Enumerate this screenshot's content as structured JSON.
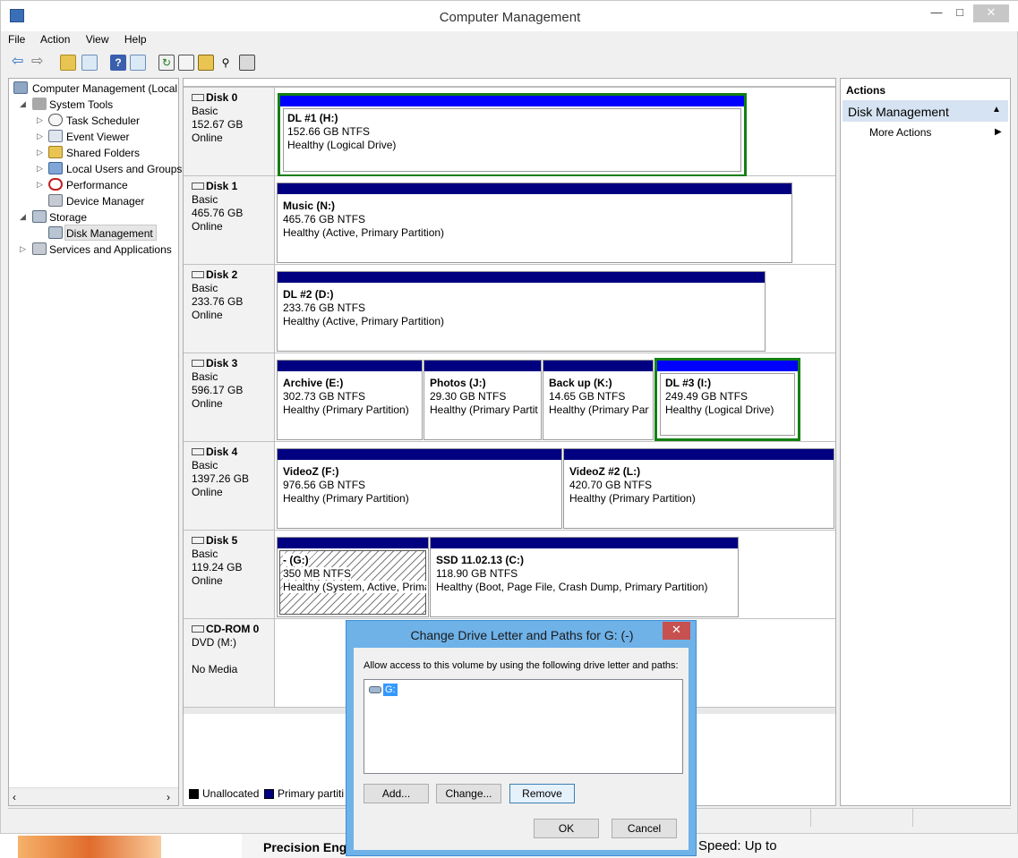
{
  "window": {
    "title": "Computer Management",
    "minimize": "—",
    "maximize": "□",
    "close": "✕"
  },
  "menu": [
    "File",
    "Action",
    "View",
    "Help"
  ],
  "toolbar": {
    "icons": [
      "back-icon",
      "forward-icon",
      "up-folder-icon",
      "show-hide-tree-icon",
      "help-icon",
      "properties-icon",
      "refresh-icon",
      "settings-icon",
      "open-folder-icon",
      "search-icon",
      "export-icon"
    ]
  },
  "tree": {
    "root": "Computer Management (Local",
    "system_tools": "System Tools",
    "task_scheduler": "Task Scheduler",
    "event_viewer": "Event Viewer",
    "shared_folders": "Shared Folders",
    "local_users": "Local Users and Groups",
    "performance": "Performance",
    "device_manager": "Device Manager",
    "storage": "Storage",
    "disk_management": "Disk Management",
    "services": "Services and Applications"
  },
  "disks": [
    {
      "name": "Disk 0",
      "type": "Basic",
      "size": "152.67 GB",
      "status": "Online",
      "parts": [
        {
          "name": "DL #1  (H:)",
          "size": "152.66 GB NTFS",
          "status": "Healthy (Logical Drive)"
        }
      ]
    },
    {
      "name": "Disk 1",
      "type": "Basic",
      "size": "465.76 GB",
      "status": "Online",
      "parts": [
        {
          "name": "Music  (N:)",
          "size": "465.76 GB NTFS",
          "status": "Healthy (Active, Primary Partition)"
        }
      ]
    },
    {
      "name": "Disk 2",
      "type": "Basic",
      "size": "233.76 GB",
      "status": "Online",
      "parts": [
        {
          "name": "DL #2  (D:)",
          "size": "233.76 GB NTFS",
          "status": "Healthy (Active, Primary Partition)"
        }
      ]
    },
    {
      "name": "Disk 3",
      "type": "Basic",
      "size": "596.17 GB",
      "status": "Online",
      "parts": [
        {
          "name": "Archive  (E:)",
          "size": "302.73 GB NTFS",
          "status": "Healthy (Primary Partition)"
        },
        {
          "name": "Photos  (J:)",
          "size": "29.30 GB NTFS",
          "status": "Healthy (Primary Partition)"
        },
        {
          "name": "Back up  (K:)",
          "size": "14.65 GB NTFS",
          "status": "Healthy (Primary Partition)"
        },
        {
          "name": "DL #3  (I:)",
          "size": "249.49 GB NTFS",
          "status": "Healthy (Logical Drive)"
        }
      ]
    },
    {
      "name": "Disk 4",
      "type": "Basic",
      "size": "1397.26 GB",
      "status": "Online",
      "parts": [
        {
          "name": "VideoZ  (F:)",
          "size": "976.56 GB NTFS",
          "status": "Healthy (Primary Partition)"
        },
        {
          "name": "VideoZ #2  (L:)",
          "size": "420.70 GB NTFS",
          "status": "Healthy (Primary Partition)"
        }
      ]
    },
    {
      "name": "Disk 5",
      "type": "Basic",
      "size": "119.24 GB",
      "status": "Online",
      "parts": [
        {
          "name": "-  (G:)",
          "size": "350 MB NTFS",
          "status": "Healthy (System, Active, Primary Partition)"
        },
        {
          "name": "SSD 11.02.13  (C:)",
          "size": "118.90 GB NTFS",
          "status": "Healthy (Boot, Page File, Crash Dump, Primary Partition)"
        }
      ]
    },
    {
      "name": "CD-ROM 0",
      "type": "DVD (M:)",
      "size": "",
      "status": "No Media",
      "parts": []
    }
  ],
  "legend": {
    "unallocated": "Unallocated",
    "primary": "Primary partiti"
  },
  "actions": {
    "header": "Actions",
    "section": "Disk Management",
    "more": "More Actions"
  },
  "dialog": {
    "title": "Change Drive Letter and Paths for G: (-)",
    "close": "✕",
    "description": "Allow access to this volume by using the following drive letter and paths:",
    "paths": [
      "G:"
    ],
    "add": "Add...",
    "change": "Change...",
    "remove": "Remove",
    "ok": "OK",
    "cancel": "Cancel"
  },
  "background": {
    "left_text": "Precision Eng",
    "right_text": "Speed: Up to"
  },
  "colors": {
    "primary_partition": "#000080",
    "logical_drive": "#0000ff",
    "selected": "#137f13",
    "unallocated": "#000000"
  }
}
